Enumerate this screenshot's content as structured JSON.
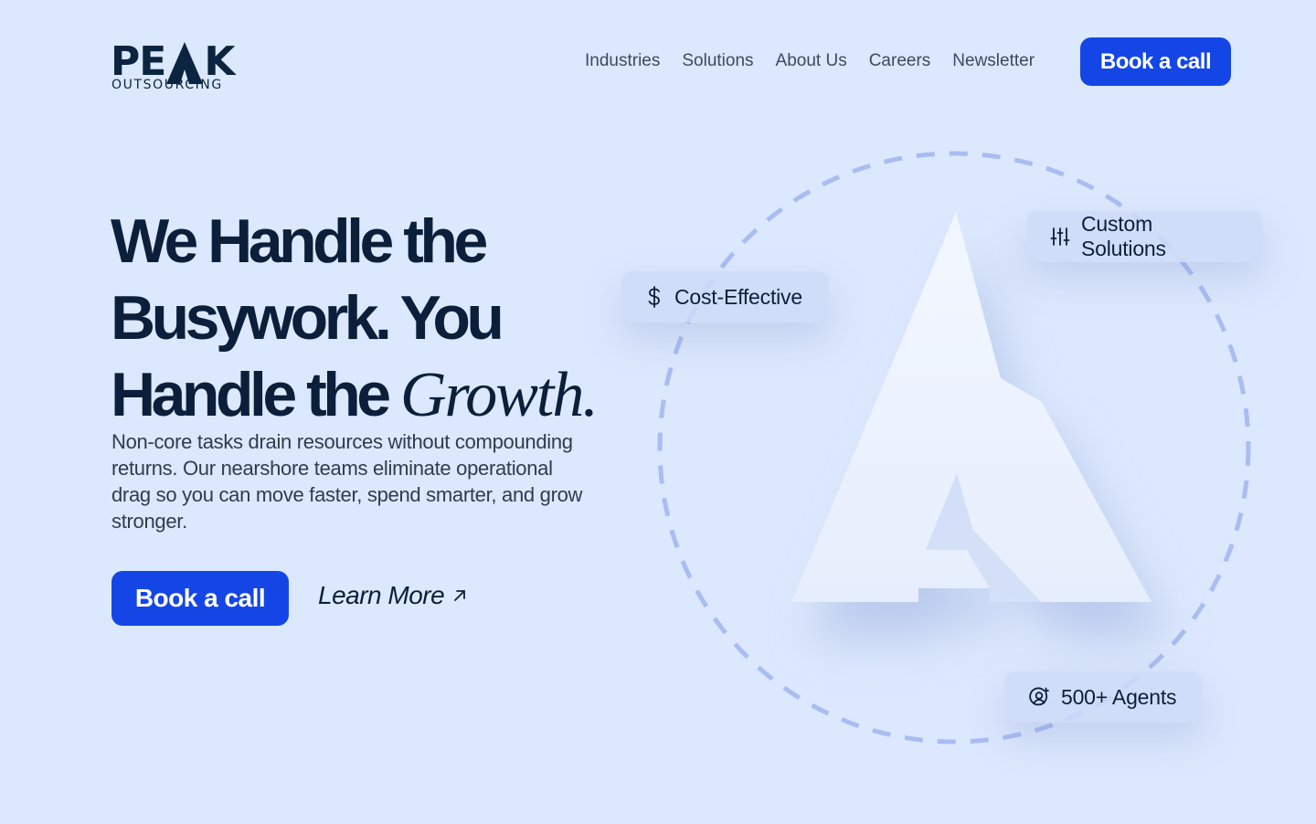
{
  "brand": {
    "name": "PEAK",
    "tagline": "OUTSOURCING",
    "colors": {
      "primary": "#1446e6",
      "navy": "#0b2540",
      "background": "#dce8fd"
    }
  },
  "nav": {
    "items": [
      {
        "label": "Industries"
      },
      {
        "label": "Solutions"
      },
      {
        "label": "About Us"
      },
      {
        "label": "Careers"
      },
      {
        "label": "Newsletter"
      }
    ],
    "cta_label": "Book a call"
  },
  "hero": {
    "title_line1": "We Handle the",
    "title_line2": "Busywork. You",
    "title_line3_prefix": "Handle the ",
    "title_accent": "Growth.",
    "description": "Non-core tasks drain resources without compounding returns. Our nearshore teams eliminate operational drag so you can move faster, spend smarter, and grow stronger.",
    "primary_cta": "Book a call",
    "secondary_cta": "Learn More",
    "secondary_cta_icon": "arrow-up-right-icon"
  },
  "features": {
    "cost": {
      "label": "Cost-Effective",
      "icon": "dollar-icon"
    },
    "custom": {
      "label": "Custom Solutions",
      "icon": "sliders-icon"
    },
    "agents": {
      "label": "500+ Agents",
      "icon": "user-circle-icon"
    }
  }
}
